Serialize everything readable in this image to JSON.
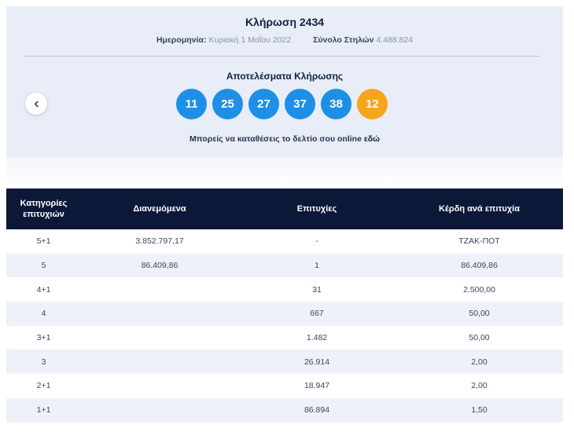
{
  "draw": {
    "title": "Κλήρωση 2434",
    "date_label": "Ημερομηνία:",
    "date_value": "Κυριακή 1 Μαΐου 2022",
    "columns_label": "Σύνολο Στηλών",
    "columns_value": "4.488.824"
  },
  "results": {
    "title": "Αποτελέσματα Κλήρωσης",
    "numbers": [
      "11",
      "25",
      "27",
      "37",
      "38"
    ],
    "bonus": "12",
    "bonus_color": "#f7a51d",
    "ball_color": "#1e8fe6"
  },
  "deposit": {
    "text": "Μπορείς να καταθέσεις το δελτίο σου online ",
    "link": "εδώ"
  },
  "nav": {
    "prev_icon": "chevron-left-icon"
  },
  "table": {
    "headers": [
      "Κατηγορίες επιτυχιών",
      "Διανεμόμενα",
      "Επιτυχίες",
      "Κέρδη ανά επιτυχία"
    ],
    "rows": [
      [
        "5+1",
        "3.852.797,17",
        "-",
        "ΤΖΑΚ-ΠΟΤ"
      ],
      [
        "5",
        "86.409,86",
        "1",
        "86.409,86"
      ],
      [
        "4+1",
        "",
        "31",
        "2.500,00"
      ],
      [
        "4",
        "",
        "667",
        "50,00"
      ],
      [
        "3+1",
        "",
        "1.482",
        "50,00"
      ],
      [
        "3",
        "",
        "26.914",
        "2,00"
      ],
      [
        "2+1",
        "",
        "18.947",
        "2,00"
      ],
      [
        "1+1",
        "",
        "86.894",
        "1,50"
      ]
    ],
    "header_color": "#0b1838"
  }
}
